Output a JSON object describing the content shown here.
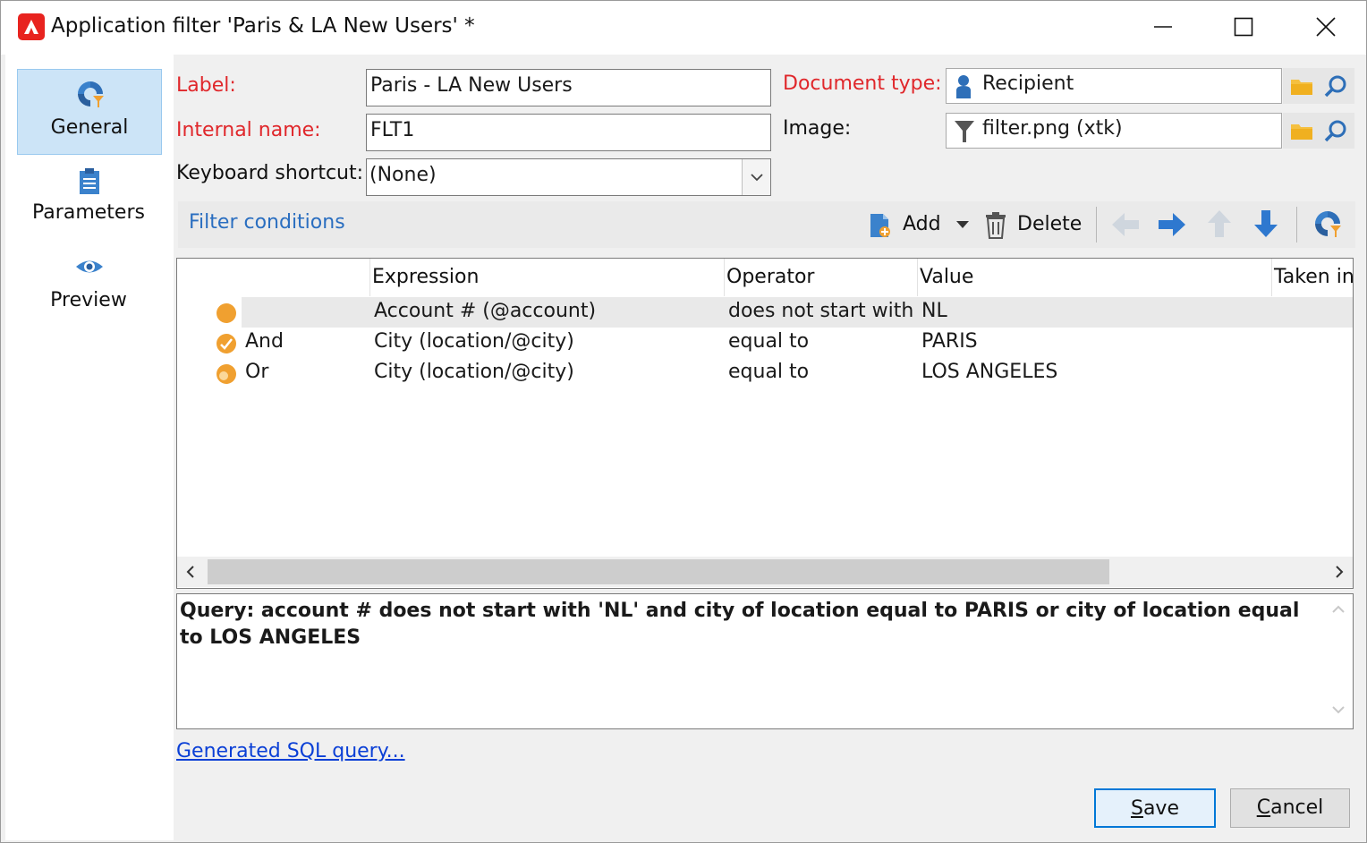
{
  "window": {
    "title": "Application filter 'Paris & LA New Users' *"
  },
  "nav": {
    "general": "General",
    "parameters": "Parameters",
    "preview": "Preview"
  },
  "form": {
    "label_label": "Label:",
    "label_value": "Paris - LA New Users",
    "internal_name_label": "Internal name:",
    "internal_name_value": "FLT1",
    "shortcut_label": "Keyboard shortcut:",
    "shortcut_value": "(None)",
    "doc_type_label": "Document type:",
    "doc_type_value": "Recipient",
    "image_label": "Image:",
    "image_value": "filter.png (xtk)"
  },
  "filter": {
    "title": "Filter conditions",
    "add_label": "Add",
    "delete_label": "Delete"
  },
  "grid": {
    "columns": [
      "Expression",
      "Operator",
      "Value",
      "Taken int"
    ],
    "rows": [
      {
        "logic": "",
        "expression": "Account # (@account)",
        "operator": "does not start with",
        "value": "NL"
      },
      {
        "logic": "And",
        "expression": "City (location/@city)",
        "operator": "equal to",
        "value": "PARIS"
      },
      {
        "logic": "Or",
        "expression": "City (location/@city)",
        "operator": "equal to",
        "value": "LOS ANGELES"
      }
    ]
  },
  "query": {
    "text": "Query: account # does not start with 'NL' and city of location equal to PARIS or city of location equal to LOS ANGELES"
  },
  "links": {
    "sql": "Generated SQL query..."
  },
  "buttons": {
    "save_first": "S",
    "save_rest": "ave",
    "cancel_first": "C",
    "cancel_rest": "ancel"
  },
  "colors": {
    "required_label": "#e0272b",
    "link": "#0a3fd6",
    "accent": "#0078d7",
    "condition_dot": "#f0a030"
  }
}
